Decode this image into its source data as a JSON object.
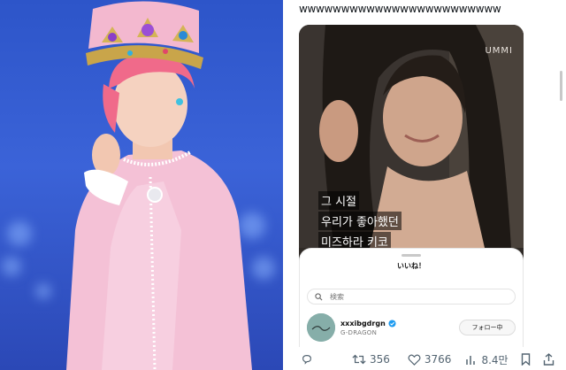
{
  "tweet": {
    "text": "wwwwwwwwwwwwwwwwwwwwwwww"
  },
  "photo": {
    "watermark": "UMMI",
    "caption_lines": [
      "그 시절",
      "우리가 좋아했던",
      "미즈하라 키코"
    ]
  },
  "likes_sheet": {
    "title": "いいね！",
    "search_placeholder": "検索",
    "user": {
      "handle": "xxxibgdrgn",
      "display_name": "G-DRAGON",
      "follow_label": "フォロー中"
    }
  },
  "actions": {
    "retweets": "356",
    "likes": "3766",
    "views": "8.4만"
  },
  "colors": {
    "stage_blue": "#3b63d8",
    "verified_blue": "#1d9bf0",
    "icon_gray": "#536471"
  }
}
